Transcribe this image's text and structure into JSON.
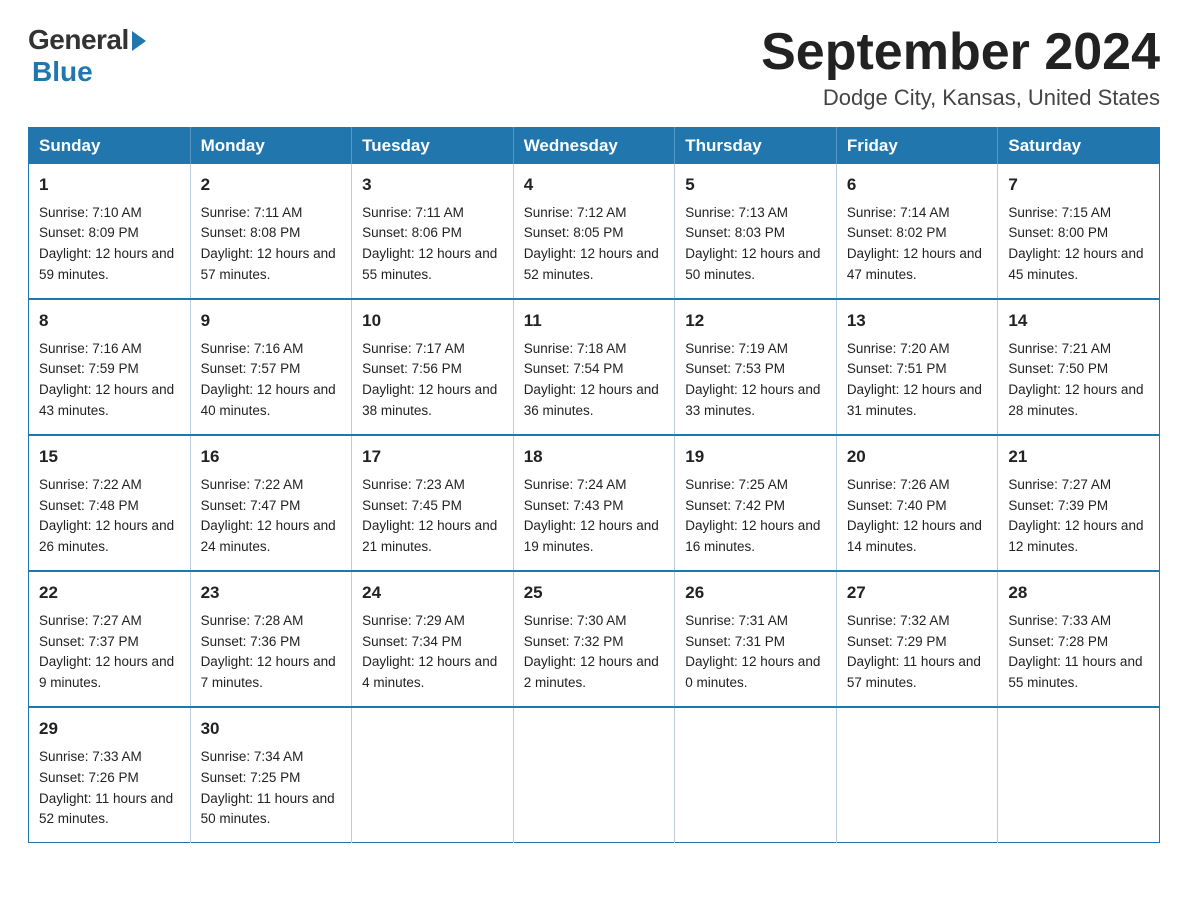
{
  "logo": {
    "general": "General",
    "blue": "Blue"
  },
  "title": {
    "month_year": "September 2024",
    "location": "Dodge City, Kansas, United States"
  },
  "headers": [
    "Sunday",
    "Monday",
    "Tuesday",
    "Wednesday",
    "Thursday",
    "Friday",
    "Saturday"
  ],
  "weeks": [
    [
      {
        "day": "1",
        "sunrise": "Sunrise: 7:10 AM",
        "sunset": "Sunset: 8:09 PM",
        "daylight": "Daylight: 12 hours and 59 minutes."
      },
      {
        "day": "2",
        "sunrise": "Sunrise: 7:11 AM",
        "sunset": "Sunset: 8:08 PM",
        "daylight": "Daylight: 12 hours and 57 minutes."
      },
      {
        "day": "3",
        "sunrise": "Sunrise: 7:11 AM",
        "sunset": "Sunset: 8:06 PM",
        "daylight": "Daylight: 12 hours and 55 minutes."
      },
      {
        "day": "4",
        "sunrise": "Sunrise: 7:12 AM",
        "sunset": "Sunset: 8:05 PM",
        "daylight": "Daylight: 12 hours and 52 minutes."
      },
      {
        "day": "5",
        "sunrise": "Sunrise: 7:13 AM",
        "sunset": "Sunset: 8:03 PM",
        "daylight": "Daylight: 12 hours and 50 minutes."
      },
      {
        "day": "6",
        "sunrise": "Sunrise: 7:14 AM",
        "sunset": "Sunset: 8:02 PM",
        "daylight": "Daylight: 12 hours and 47 minutes."
      },
      {
        "day": "7",
        "sunrise": "Sunrise: 7:15 AM",
        "sunset": "Sunset: 8:00 PM",
        "daylight": "Daylight: 12 hours and 45 minutes."
      }
    ],
    [
      {
        "day": "8",
        "sunrise": "Sunrise: 7:16 AM",
        "sunset": "Sunset: 7:59 PM",
        "daylight": "Daylight: 12 hours and 43 minutes."
      },
      {
        "day": "9",
        "sunrise": "Sunrise: 7:16 AM",
        "sunset": "Sunset: 7:57 PM",
        "daylight": "Daylight: 12 hours and 40 minutes."
      },
      {
        "day": "10",
        "sunrise": "Sunrise: 7:17 AM",
        "sunset": "Sunset: 7:56 PM",
        "daylight": "Daylight: 12 hours and 38 minutes."
      },
      {
        "day": "11",
        "sunrise": "Sunrise: 7:18 AM",
        "sunset": "Sunset: 7:54 PM",
        "daylight": "Daylight: 12 hours and 36 minutes."
      },
      {
        "day": "12",
        "sunrise": "Sunrise: 7:19 AM",
        "sunset": "Sunset: 7:53 PM",
        "daylight": "Daylight: 12 hours and 33 minutes."
      },
      {
        "day": "13",
        "sunrise": "Sunrise: 7:20 AM",
        "sunset": "Sunset: 7:51 PM",
        "daylight": "Daylight: 12 hours and 31 minutes."
      },
      {
        "day": "14",
        "sunrise": "Sunrise: 7:21 AM",
        "sunset": "Sunset: 7:50 PM",
        "daylight": "Daylight: 12 hours and 28 minutes."
      }
    ],
    [
      {
        "day": "15",
        "sunrise": "Sunrise: 7:22 AM",
        "sunset": "Sunset: 7:48 PM",
        "daylight": "Daylight: 12 hours and 26 minutes."
      },
      {
        "day": "16",
        "sunrise": "Sunrise: 7:22 AM",
        "sunset": "Sunset: 7:47 PM",
        "daylight": "Daylight: 12 hours and 24 minutes."
      },
      {
        "day": "17",
        "sunrise": "Sunrise: 7:23 AM",
        "sunset": "Sunset: 7:45 PM",
        "daylight": "Daylight: 12 hours and 21 minutes."
      },
      {
        "day": "18",
        "sunrise": "Sunrise: 7:24 AM",
        "sunset": "Sunset: 7:43 PM",
        "daylight": "Daylight: 12 hours and 19 minutes."
      },
      {
        "day": "19",
        "sunrise": "Sunrise: 7:25 AM",
        "sunset": "Sunset: 7:42 PM",
        "daylight": "Daylight: 12 hours and 16 minutes."
      },
      {
        "day": "20",
        "sunrise": "Sunrise: 7:26 AM",
        "sunset": "Sunset: 7:40 PM",
        "daylight": "Daylight: 12 hours and 14 minutes."
      },
      {
        "day": "21",
        "sunrise": "Sunrise: 7:27 AM",
        "sunset": "Sunset: 7:39 PM",
        "daylight": "Daylight: 12 hours and 12 minutes."
      }
    ],
    [
      {
        "day": "22",
        "sunrise": "Sunrise: 7:27 AM",
        "sunset": "Sunset: 7:37 PM",
        "daylight": "Daylight: 12 hours and 9 minutes."
      },
      {
        "day": "23",
        "sunrise": "Sunrise: 7:28 AM",
        "sunset": "Sunset: 7:36 PM",
        "daylight": "Daylight: 12 hours and 7 minutes."
      },
      {
        "day": "24",
        "sunrise": "Sunrise: 7:29 AM",
        "sunset": "Sunset: 7:34 PM",
        "daylight": "Daylight: 12 hours and 4 minutes."
      },
      {
        "day": "25",
        "sunrise": "Sunrise: 7:30 AM",
        "sunset": "Sunset: 7:32 PM",
        "daylight": "Daylight: 12 hours and 2 minutes."
      },
      {
        "day": "26",
        "sunrise": "Sunrise: 7:31 AM",
        "sunset": "Sunset: 7:31 PM",
        "daylight": "Daylight: 12 hours and 0 minutes."
      },
      {
        "day": "27",
        "sunrise": "Sunrise: 7:32 AM",
        "sunset": "Sunset: 7:29 PM",
        "daylight": "Daylight: 11 hours and 57 minutes."
      },
      {
        "day": "28",
        "sunrise": "Sunrise: 7:33 AM",
        "sunset": "Sunset: 7:28 PM",
        "daylight": "Daylight: 11 hours and 55 minutes."
      }
    ],
    [
      {
        "day": "29",
        "sunrise": "Sunrise: 7:33 AM",
        "sunset": "Sunset: 7:26 PM",
        "daylight": "Daylight: 11 hours and 52 minutes."
      },
      {
        "day": "30",
        "sunrise": "Sunrise: 7:34 AM",
        "sunset": "Sunset: 7:25 PM",
        "daylight": "Daylight: 11 hours and 50 minutes."
      },
      null,
      null,
      null,
      null,
      null
    ]
  ]
}
